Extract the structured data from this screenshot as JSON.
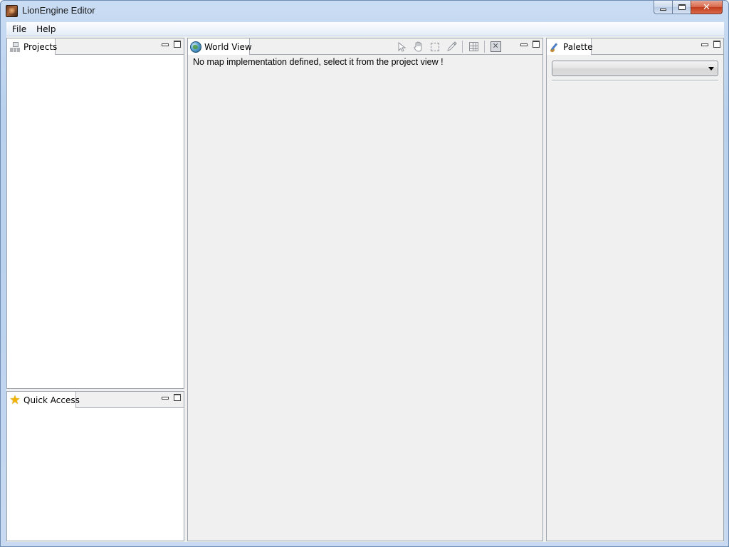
{
  "window": {
    "title": "LionEngine Editor"
  },
  "menubar": {
    "items": [
      "File",
      "Help"
    ]
  },
  "panels": {
    "projects": {
      "tab_label": "Projects"
    },
    "quick_access": {
      "tab_label": "Quick Access"
    },
    "world_view": {
      "tab_label": "World View",
      "message": "No map implementation defined, select it from the project view !"
    },
    "palette": {
      "tab_label": "Palette",
      "combo_value": ""
    }
  },
  "icons": {
    "app": "lion-icon",
    "projects": "projects-tree-icon",
    "quick_access": "star-icon",
    "world_view": "globe-icon",
    "palette": "brush-icon",
    "world_tools": [
      "pointer-icon",
      "hand-icon",
      "select-icon",
      "picker-icon",
      "grid-icon",
      "layer-icon"
    ]
  }
}
